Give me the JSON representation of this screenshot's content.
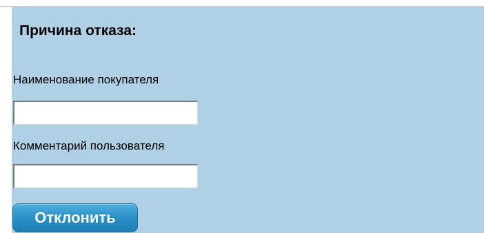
{
  "form": {
    "title": "Причина отказа:",
    "buyer_name_label": "Наименование покупателя",
    "buyer_name_value": "",
    "user_comment_label": "Комментарий пользователя",
    "user_comment_value": "",
    "reject_button_label": "Отклонить"
  },
  "colors": {
    "panel_background": "#b0d0e6",
    "button_background": "#2a90c8",
    "button_text": "#ffffff"
  }
}
